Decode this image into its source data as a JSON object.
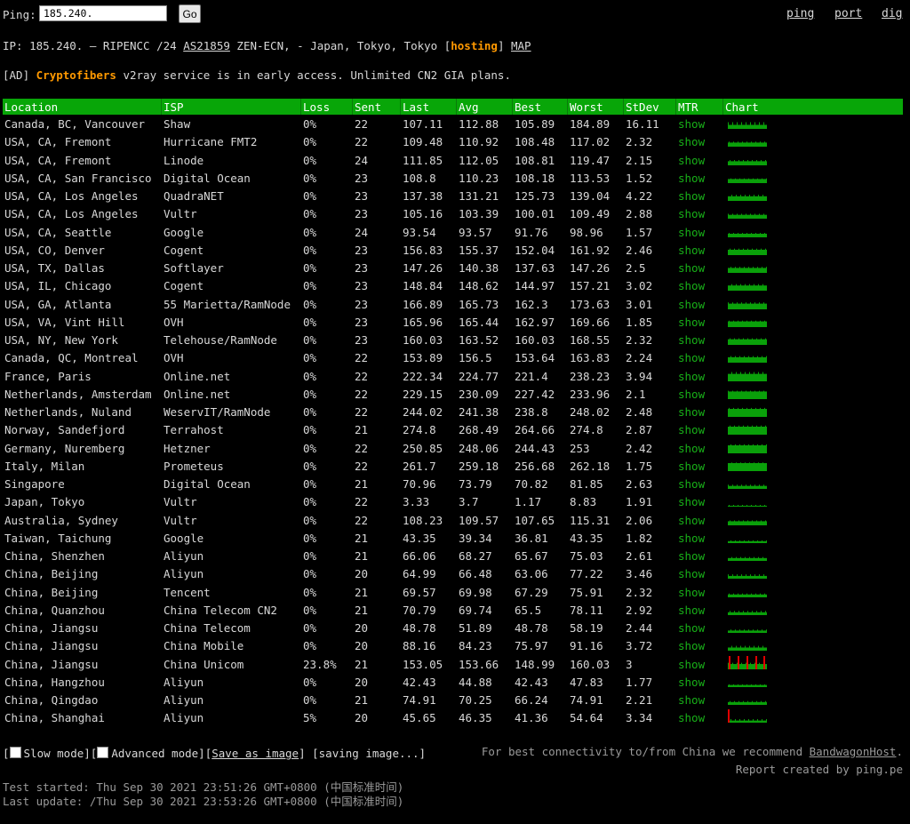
{
  "top": {
    "ping_label": "Ping:",
    "ping_value": "185.240.",
    "go_label": "Go",
    "nav": [
      "ping",
      "port",
      "dig"
    ]
  },
  "info": {
    "ip_prefix": "IP: 185.240.",
    "ip_suffix": " – RIPENCC /24 ",
    "as_link": "AS21859",
    "after_as": " ZEN-ECN, - Japan, Tokyo, Tokyo [",
    "hosting": "hosting",
    "after_hosting": "] ",
    "map": "MAP"
  },
  "ad": {
    "prefix": "[AD] ",
    "brand": "Cryptofibers",
    "text": " v2ray service is in early access. Unlimited CN2 GIA plans."
  },
  "table": {
    "headers": [
      "Location",
      "ISP",
      "Loss",
      "Sent",
      "Last",
      "Avg",
      "Best",
      "Worst",
      "StDev",
      "MTR",
      "Chart"
    ],
    "mtr_label": "show",
    "rows": [
      [
        "Canada, BC, Vancouver",
        "Shaw",
        "0%",
        "22",
        "107.11",
        "112.88",
        "105.89",
        "184.89",
        "16.11"
      ],
      [
        "USA, CA, Fremont",
        "Hurricane FMT2",
        "0%",
        "22",
        "109.48",
        "110.92",
        "108.48",
        "117.02",
        "2.32"
      ],
      [
        "USA, CA, Fremont",
        "Linode",
        "0%",
        "24",
        "111.85",
        "112.05",
        "108.81",
        "119.47",
        "2.15"
      ],
      [
        "USA, CA, San Francisco",
        "Digital Ocean",
        "0%",
        "23",
        "108.8",
        "110.23",
        "108.18",
        "113.53",
        "1.52"
      ],
      [
        "USA, CA, Los Angeles",
        "QuadraNET",
        "0%",
        "23",
        "137.38",
        "131.21",
        "125.73",
        "139.04",
        "4.22"
      ],
      [
        "USA, CA, Los Angeles",
        "Vultr",
        "0%",
        "23",
        "105.16",
        "103.39",
        "100.01",
        "109.49",
        "2.88"
      ],
      [
        "USA, CA, Seattle",
        "Google",
        "0%",
        "24",
        "93.54",
        "93.57",
        "91.76",
        "98.96",
        "1.57"
      ],
      [
        "USA, CO, Denver",
        "Cogent",
        "0%",
        "23",
        "156.83",
        "155.37",
        "152.04",
        "161.92",
        "2.46"
      ],
      [
        "USA, TX, Dallas",
        "Softlayer",
        "0%",
        "23",
        "147.26",
        "140.38",
        "137.63",
        "147.26",
        "2.5"
      ],
      [
        "USA, IL, Chicago",
        "Cogent",
        "0%",
        "23",
        "148.84",
        "148.62",
        "144.97",
        "157.21",
        "3.02"
      ],
      [
        "USA, GA, Atlanta",
        "55 Marietta/RamNode",
        "0%",
        "23",
        "166.89",
        "165.73",
        "162.3",
        "173.63",
        "3.01"
      ],
      [
        "USA, VA, Vint Hill",
        "OVH",
        "0%",
        "23",
        "165.96",
        "165.44",
        "162.97",
        "169.66",
        "1.85"
      ],
      [
        "USA, NY, New York",
        "Telehouse/RamNode",
        "0%",
        "23",
        "160.03",
        "163.52",
        "160.03",
        "168.55",
        "2.32"
      ],
      [
        "Canada, QC, Montreal",
        "OVH",
        "0%",
        "22",
        "153.89",
        "156.5",
        "153.64",
        "163.83",
        "2.24"
      ],
      [
        "France, Paris",
        "Online.net",
        "0%",
        "22",
        "222.34",
        "224.77",
        "221.4",
        "238.23",
        "3.94"
      ],
      [
        "Netherlands, Amsterdam",
        "Online.net",
        "0%",
        "22",
        "229.15",
        "230.09",
        "227.42",
        "233.96",
        "2.1"
      ],
      [
        "Netherlands, Nuland",
        "WeservIT/RamNode",
        "0%",
        "22",
        "244.02",
        "241.38",
        "238.8",
        "248.02",
        "2.48"
      ],
      [
        "Norway, Sandefjord",
        "Terrahost",
        "0%",
        "21",
        "274.8",
        "268.49",
        "264.66",
        "274.8",
        "2.87"
      ],
      [
        "Germany, Nuremberg",
        "Hetzner",
        "0%",
        "22",
        "250.85",
        "248.06",
        "244.43",
        "253",
        "2.42"
      ],
      [
        "Italy, Milan",
        "Prometeus",
        "0%",
        "22",
        "261.7",
        "259.18",
        "256.68",
        "262.18",
        "1.75"
      ],
      [
        "Singapore",
        "Digital Ocean",
        "0%",
        "21",
        "70.96",
        "73.79",
        "70.82",
        "81.85",
        "2.63"
      ],
      [
        "Japan, Tokyo",
        "Vultr",
        "0%",
        "22",
        "3.33",
        "3.7",
        "1.17",
        "8.83",
        "1.91"
      ],
      [
        "Australia, Sydney",
        "Vultr",
        "0%",
        "22",
        "108.23",
        "109.57",
        "107.65",
        "115.31",
        "2.06"
      ],
      [
        "Taiwan, Taichung",
        "Google",
        "0%",
        "21",
        "43.35",
        "39.34",
        "36.81",
        "43.35",
        "1.82"
      ],
      [
        "China, Shenzhen",
        "Aliyun",
        "0%",
        "21",
        "66.06",
        "68.27",
        "65.67",
        "75.03",
        "2.61"
      ],
      [
        "China, Beijing",
        "Aliyun",
        "0%",
        "20",
        "64.99",
        "66.48",
        "63.06",
        "77.22",
        "3.46"
      ],
      [
        "China, Beijing",
        "Tencent",
        "0%",
        "21",
        "69.57",
        "69.98",
        "67.29",
        "75.91",
        "2.32"
      ],
      [
        "China, Quanzhou",
        "China Telecom CN2",
        "0%",
        "21",
        "70.79",
        "69.74",
        "65.5",
        "78.11",
        "2.92"
      ],
      [
        "China, Jiangsu",
        "China Telecom",
        "0%",
        "20",
        "48.78",
        "51.89",
        "48.78",
        "58.19",
        "2.44"
      ],
      [
        "China, Jiangsu",
        "China Mobile",
        "0%",
        "20",
        "88.16",
        "84.23",
        "75.97",
        "91.16",
        "3.72"
      ],
      [
        "China, Jiangsu",
        "China Unicom",
        "23.8%",
        "21",
        "153.05",
        "153.66",
        "148.99",
        "160.03",
        "3"
      ],
      [
        "China, Hangzhou",
        "Aliyun",
        "0%",
        "20",
        "42.43",
        "44.88",
        "42.43",
        "47.83",
        "1.77"
      ],
      [
        "China, Qingdao",
        "Aliyun",
        "0%",
        "21",
        "74.91",
        "70.25",
        "66.24",
        "74.91",
        "2.21"
      ],
      [
        "China, Shanghai",
        "Aliyun",
        "5%",
        "20",
        "45.65",
        "46.35",
        "41.36",
        "54.64",
        "3.34"
      ]
    ]
  },
  "footer": {
    "open_bracket": "[",
    "slow_mode": "Slow mode",
    "mid_bracket": "][",
    "advanced_mode": "Advanced mode",
    "close_open": "][",
    "save_image": "Save as image",
    "close_bracket": "]",
    "saving": " [saving image...]",
    "recommend_text": "For best connectivity to/from China we recommend ",
    "recommend_link": "BandwagonHost",
    "recommend_end": ".",
    "report_by": "Report created by ping.pe",
    "started": "Test started: Thu Sep 30 2021 23:51:26 GMT+0800 (中国标准时间)",
    "updated": "Last update: /Thu Sep 30 2021 23:53:26 GMT+0800 (中国标准时间)"
  },
  "colors": {
    "header_green": "#08a608",
    "mtr_green": "#18b018",
    "bar_green": "#0aa00a",
    "loss_red": "#e00000",
    "ad_orange": "#ff9900"
  }
}
